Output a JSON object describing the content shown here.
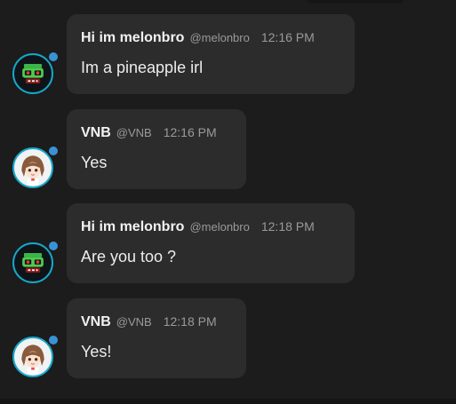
{
  "messages": [
    {
      "author": "Hi im melonbro",
      "handle": "@melonbro",
      "time": "12:16 PM",
      "text": "Im a pineapple irl",
      "avatar_icon": "melon-avatar-icon"
    },
    {
      "author": "VNB",
      "handle": "@VNB",
      "time": "12:16 PM",
      "text": "Yes",
      "avatar_icon": "anime-girl-avatar-icon"
    },
    {
      "author": "Hi im melonbro",
      "handle": "@melonbro",
      "time": "12:18 PM",
      "text": "Are you too ?",
      "avatar_icon": "melon-avatar-icon"
    },
    {
      "author": "VNB",
      "handle": "@VNB",
      "time": "12:18 PM",
      "text": "Yes!",
      "avatar_icon": "anime-girl-avatar-icon"
    }
  ],
  "colors": {
    "background": "#1c1c1c",
    "bubble": "#2c2c2c",
    "name": "#f2f2f2",
    "meta": "#9a9a9a",
    "avatar_ring": "#16a7c9",
    "status_dot": "#3a92d6"
  }
}
